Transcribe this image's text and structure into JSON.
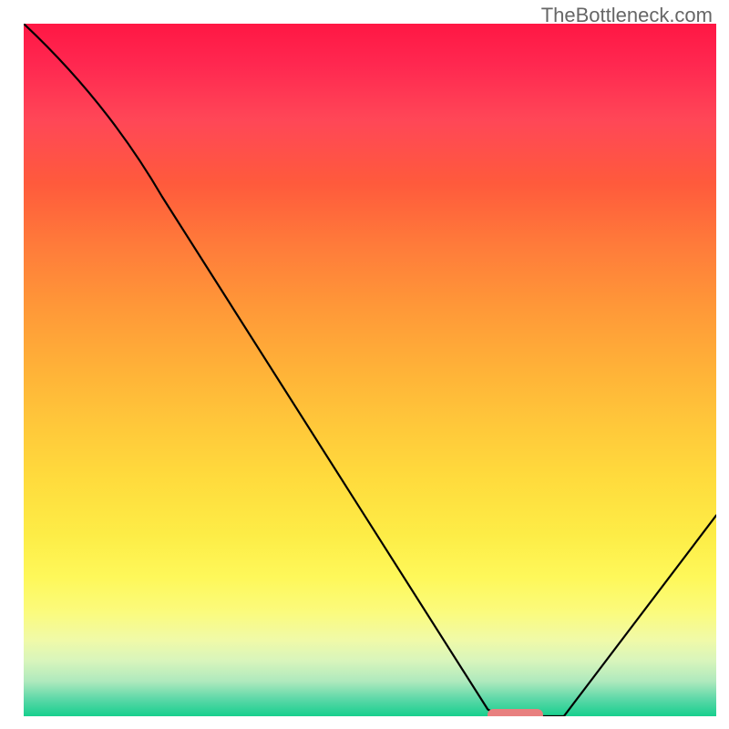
{
  "watermark": "TheBottleneck.com",
  "chart_data": {
    "type": "line",
    "title": "",
    "xlabel": "",
    "ylabel": "",
    "xlim": [
      0,
      100
    ],
    "ylim": [
      0,
      100
    ],
    "x": [
      0,
      20,
      67,
      72,
      78,
      100
    ],
    "values": [
      100,
      75,
      1,
      0,
      0,
      29
    ],
    "marker": {
      "x_start": 67,
      "x_end": 75,
      "y": 0
    },
    "gradient": {
      "top_color": "#ff1744",
      "mid_color": "#ffdc3d",
      "bottom_color": "#17cf8e"
    }
  }
}
